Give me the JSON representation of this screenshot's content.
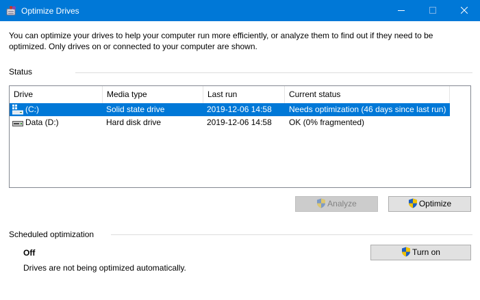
{
  "window": {
    "title": "Optimize Drives"
  },
  "description": "You can optimize your drives to help your computer run more efficiently, or analyze them to find out if they need to be optimized. Only drives on or connected to your computer are shown.",
  "status": {
    "section_label": "Status",
    "columns": [
      "Drive",
      "Media type",
      "Last run",
      "Current status"
    ],
    "drives": [
      {
        "icon": "ssd-system-drive-icon",
        "name": "(C:)",
        "media_type": "Solid state drive",
        "last_run": "2019-12-06 14:58",
        "current_status": "Needs optimization (46 days since last run)",
        "selected": true
      },
      {
        "icon": "hard-disk-drive-icon",
        "name": "Data (D:)",
        "media_type": "Hard disk drive",
        "last_run": "2019-12-06 14:58",
        "current_status": "OK (0% fragmented)",
        "selected": false
      }
    ],
    "analyze_label": "Analyze",
    "optimize_label": "Optimize"
  },
  "scheduled": {
    "section_label": "Scheduled optimization",
    "state": "Off",
    "description": "Drives are not being optimized automatically.",
    "turn_on_label": "Turn on"
  },
  "colors": {
    "accent": "#0078d7",
    "selection": "#0078d7",
    "window_bg": "#ffffff"
  }
}
